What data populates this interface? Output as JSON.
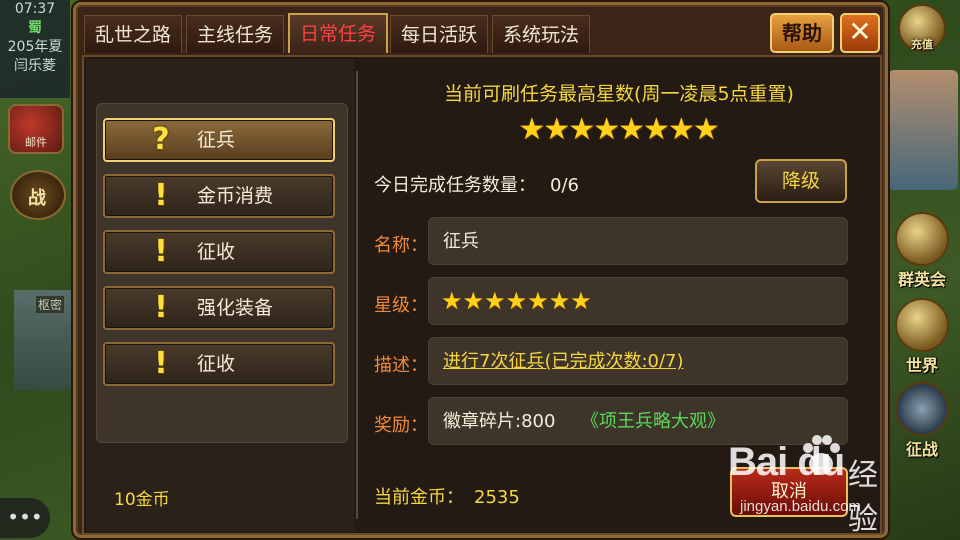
{
  "hud_left": {
    "time": "07:37",
    "kingdom": "蜀",
    "year": "205年夏",
    "city": "闫乐菱",
    "mail_label": "邮件",
    "war_label": "战",
    "building_label": "枢密",
    "chat_icon": "•••"
  },
  "hud_right": {
    "recharge": "充值",
    "heroes": "群英会",
    "world": "世界",
    "campaign": "征战"
  },
  "tabs": [
    {
      "label": "乱世之路"
    },
    {
      "label": "主线任务"
    },
    {
      "label": "日常任务",
      "active": true
    },
    {
      "label": "每日活跃"
    },
    {
      "label": "系统玩法"
    }
  ],
  "help_label": "帮助",
  "close_icon": "close-icon",
  "tasks": [
    {
      "name": "征兵",
      "mark": "?",
      "selected": true
    },
    {
      "name": "金币消费",
      "mark": "!"
    },
    {
      "name": "征收",
      "mark": "!"
    },
    {
      "name": "强化装备",
      "mark": "!"
    },
    {
      "name": "征收",
      "mark": "!"
    }
  ],
  "refresh_cost": "10金币",
  "detail": {
    "max_stars_title": "当前可刷任务最高星数(周一凌晨5点重置)",
    "max_stars": 8,
    "today_label": "今日完成任务数量：",
    "today_count": "0/6",
    "downgrade_label": "降级",
    "name_label": "名称：",
    "name_value": "征兵",
    "star_label": "星级：",
    "star_level": 7,
    "desc_label": "描述：",
    "desc_value": "进行7次征兵(已完成次数:0/7)",
    "reward_label": "奖励：",
    "reward_value": "徽章碎片:800",
    "reward_book": "《项王兵略大观》",
    "gold_label": "当前金币：",
    "gold_value": "2535",
    "cancel_label": "取消"
  },
  "colors": {
    "accent_gold": "#f5d640",
    "label_orange": "#f08a3a",
    "active_tab_red": "#ff4040",
    "reward_green": "#5ad85a"
  },
  "watermark": {
    "brand": "Bai  du",
    "cn": "经验",
    "url": "jingyan.baidu.com"
  }
}
